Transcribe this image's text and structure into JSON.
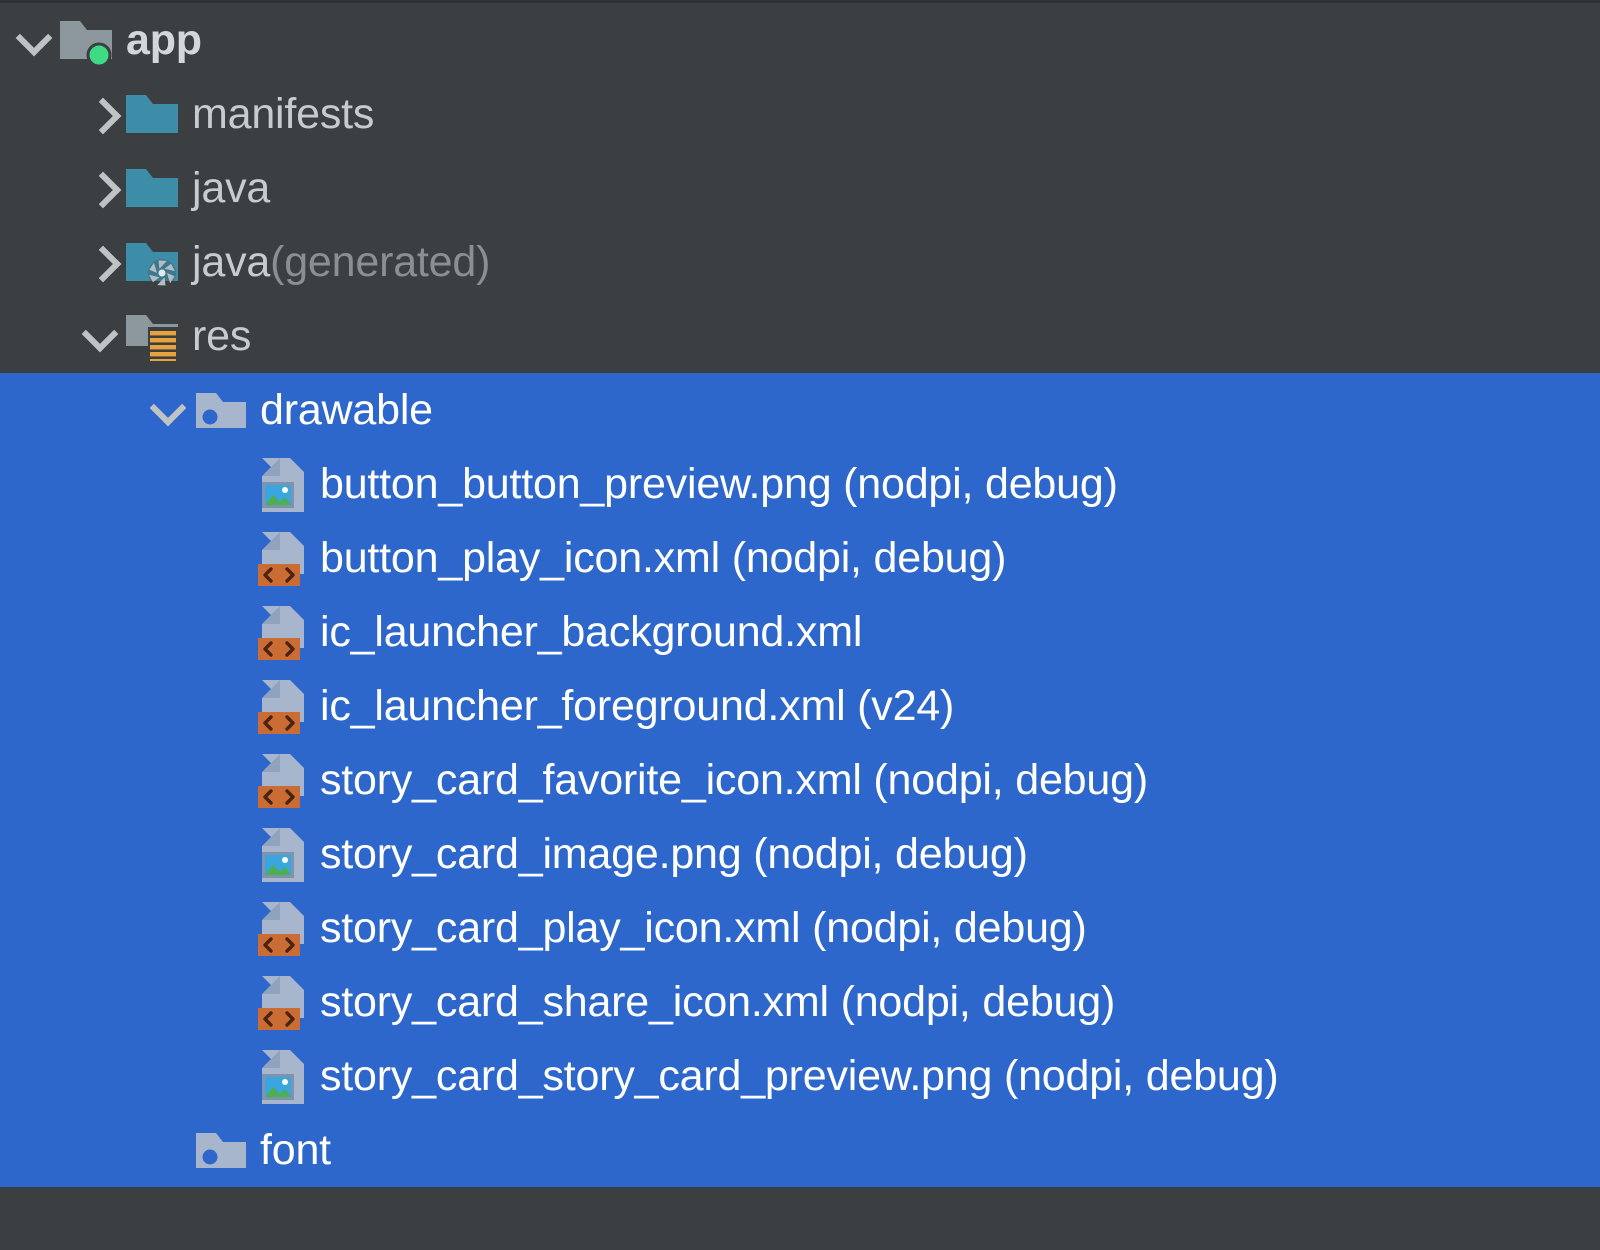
{
  "panel": {
    "name": "android-project-tree",
    "background_color": "#3c3f41",
    "selection_color": "#2e67cc",
    "text_color": "#c8cbcd",
    "selected_text_color": "#ffffff"
  },
  "tree": {
    "nodes": [
      {
        "label": "app",
        "suffix": "",
        "depth": 0,
        "chevron": "down",
        "icon": "module-folder-icon",
        "selected": false,
        "bold": true
      },
      {
        "label": "manifests",
        "suffix": "",
        "depth": 1,
        "chevron": "right",
        "icon": "source-folder-icon",
        "selected": false,
        "bold": false
      },
      {
        "label": "java",
        "suffix": "",
        "depth": 1,
        "chevron": "right",
        "icon": "source-folder-icon",
        "selected": false,
        "bold": false
      },
      {
        "label": "java",
        "suffix": " (generated)",
        "depth": 1,
        "chevron": "right",
        "icon": "generated-folder-icon",
        "selected": false,
        "bold": false
      },
      {
        "label": "res",
        "suffix": "",
        "depth": 1,
        "chevron": "down",
        "icon": "res-folder-icon",
        "selected": false,
        "bold": false
      },
      {
        "label": "drawable",
        "suffix": "",
        "depth": 2,
        "chevron": "down",
        "icon": "resource-folder-icon",
        "selected": true,
        "bold": false
      },
      {
        "label": "button_button_preview.png (nodpi, debug)",
        "suffix": "",
        "depth": 3,
        "chevron": "none",
        "icon": "png-file-icon",
        "selected": true,
        "bold": false
      },
      {
        "label": "button_play_icon.xml (nodpi, debug)",
        "suffix": "",
        "depth": 3,
        "chevron": "none",
        "icon": "xml-file-icon",
        "selected": true,
        "bold": false
      },
      {
        "label": "ic_launcher_background.xml",
        "suffix": "",
        "depth": 3,
        "chevron": "none",
        "icon": "xml-file-icon",
        "selected": true,
        "bold": false
      },
      {
        "label": "ic_launcher_foreground.xml (v24)",
        "suffix": "",
        "depth": 3,
        "chevron": "none",
        "icon": "xml-file-icon",
        "selected": true,
        "bold": false
      },
      {
        "label": "story_card_favorite_icon.xml (nodpi, debug)",
        "suffix": "",
        "depth": 3,
        "chevron": "none",
        "icon": "xml-file-icon",
        "selected": true,
        "bold": false
      },
      {
        "label": "story_card_image.png (nodpi, debug)",
        "suffix": "",
        "depth": 3,
        "chevron": "none",
        "icon": "png-file-icon",
        "selected": true,
        "bold": false
      },
      {
        "label": "story_card_play_icon.xml (nodpi, debug)",
        "suffix": "",
        "depth": 3,
        "chevron": "none",
        "icon": "xml-file-icon",
        "selected": true,
        "bold": false
      },
      {
        "label": "story_card_share_icon.xml (nodpi, debug)",
        "suffix": "",
        "depth": 3,
        "chevron": "none",
        "icon": "xml-file-icon",
        "selected": true,
        "bold": false
      },
      {
        "label": "story_card_story_card_preview.png (nodpi, debug)",
        "suffix": "",
        "depth": 3,
        "chevron": "none",
        "icon": "png-file-icon",
        "selected": true,
        "bold": false
      },
      {
        "label": "font",
        "suffix": "",
        "depth": 2,
        "chevron": "none",
        "icon": "resource-folder-icon",
        "selected": true,
        "bold": false
      }
    ]
  }
}
